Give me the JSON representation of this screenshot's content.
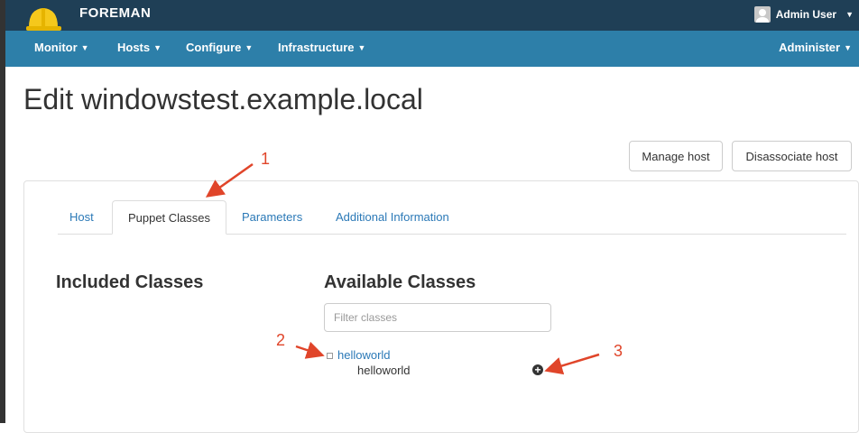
{
  "header": {
    "brand": "FOREMAN",
    "user": "Admin User"
  },
  "nav": {
    "items": [
      {
        "label": "Monitor"
      },
      {
        "label": "Hosts"
      },
      {
        "label": "Configure"
      },
      {
        "label": "Infrastructure"
      }
    ],
    "right": "Administer"
  },
  "page": {
    "title": "Edit windowstest.example.local",
    "buttons": {
      "manage": "Manage host",
      "disassociate": "Disassociate host"
    }
  },
  "tabs": [
    "Host",
    "Puppet Classes",
    "Parameters",
    "Additional Information"
  ],
  "active_tab": "Puppet Classes",
  "classes": {
    "included_title": "Included Classes",
    "available_title": "Available Classes",
    "filter_placeholder": "Filter classes",
    "group": "helloworld",
    "items": [
      "helloworld"
    ]
  },
  "annotations": [
    "1",
    "2",
    "3"
  ],
  "colors": {
    "topbar": "#1f3f56",
    "navbar": "#2d7fa9",
    "link": "#2b79b7",
    "annotation": "#e0452a"
  }
}
